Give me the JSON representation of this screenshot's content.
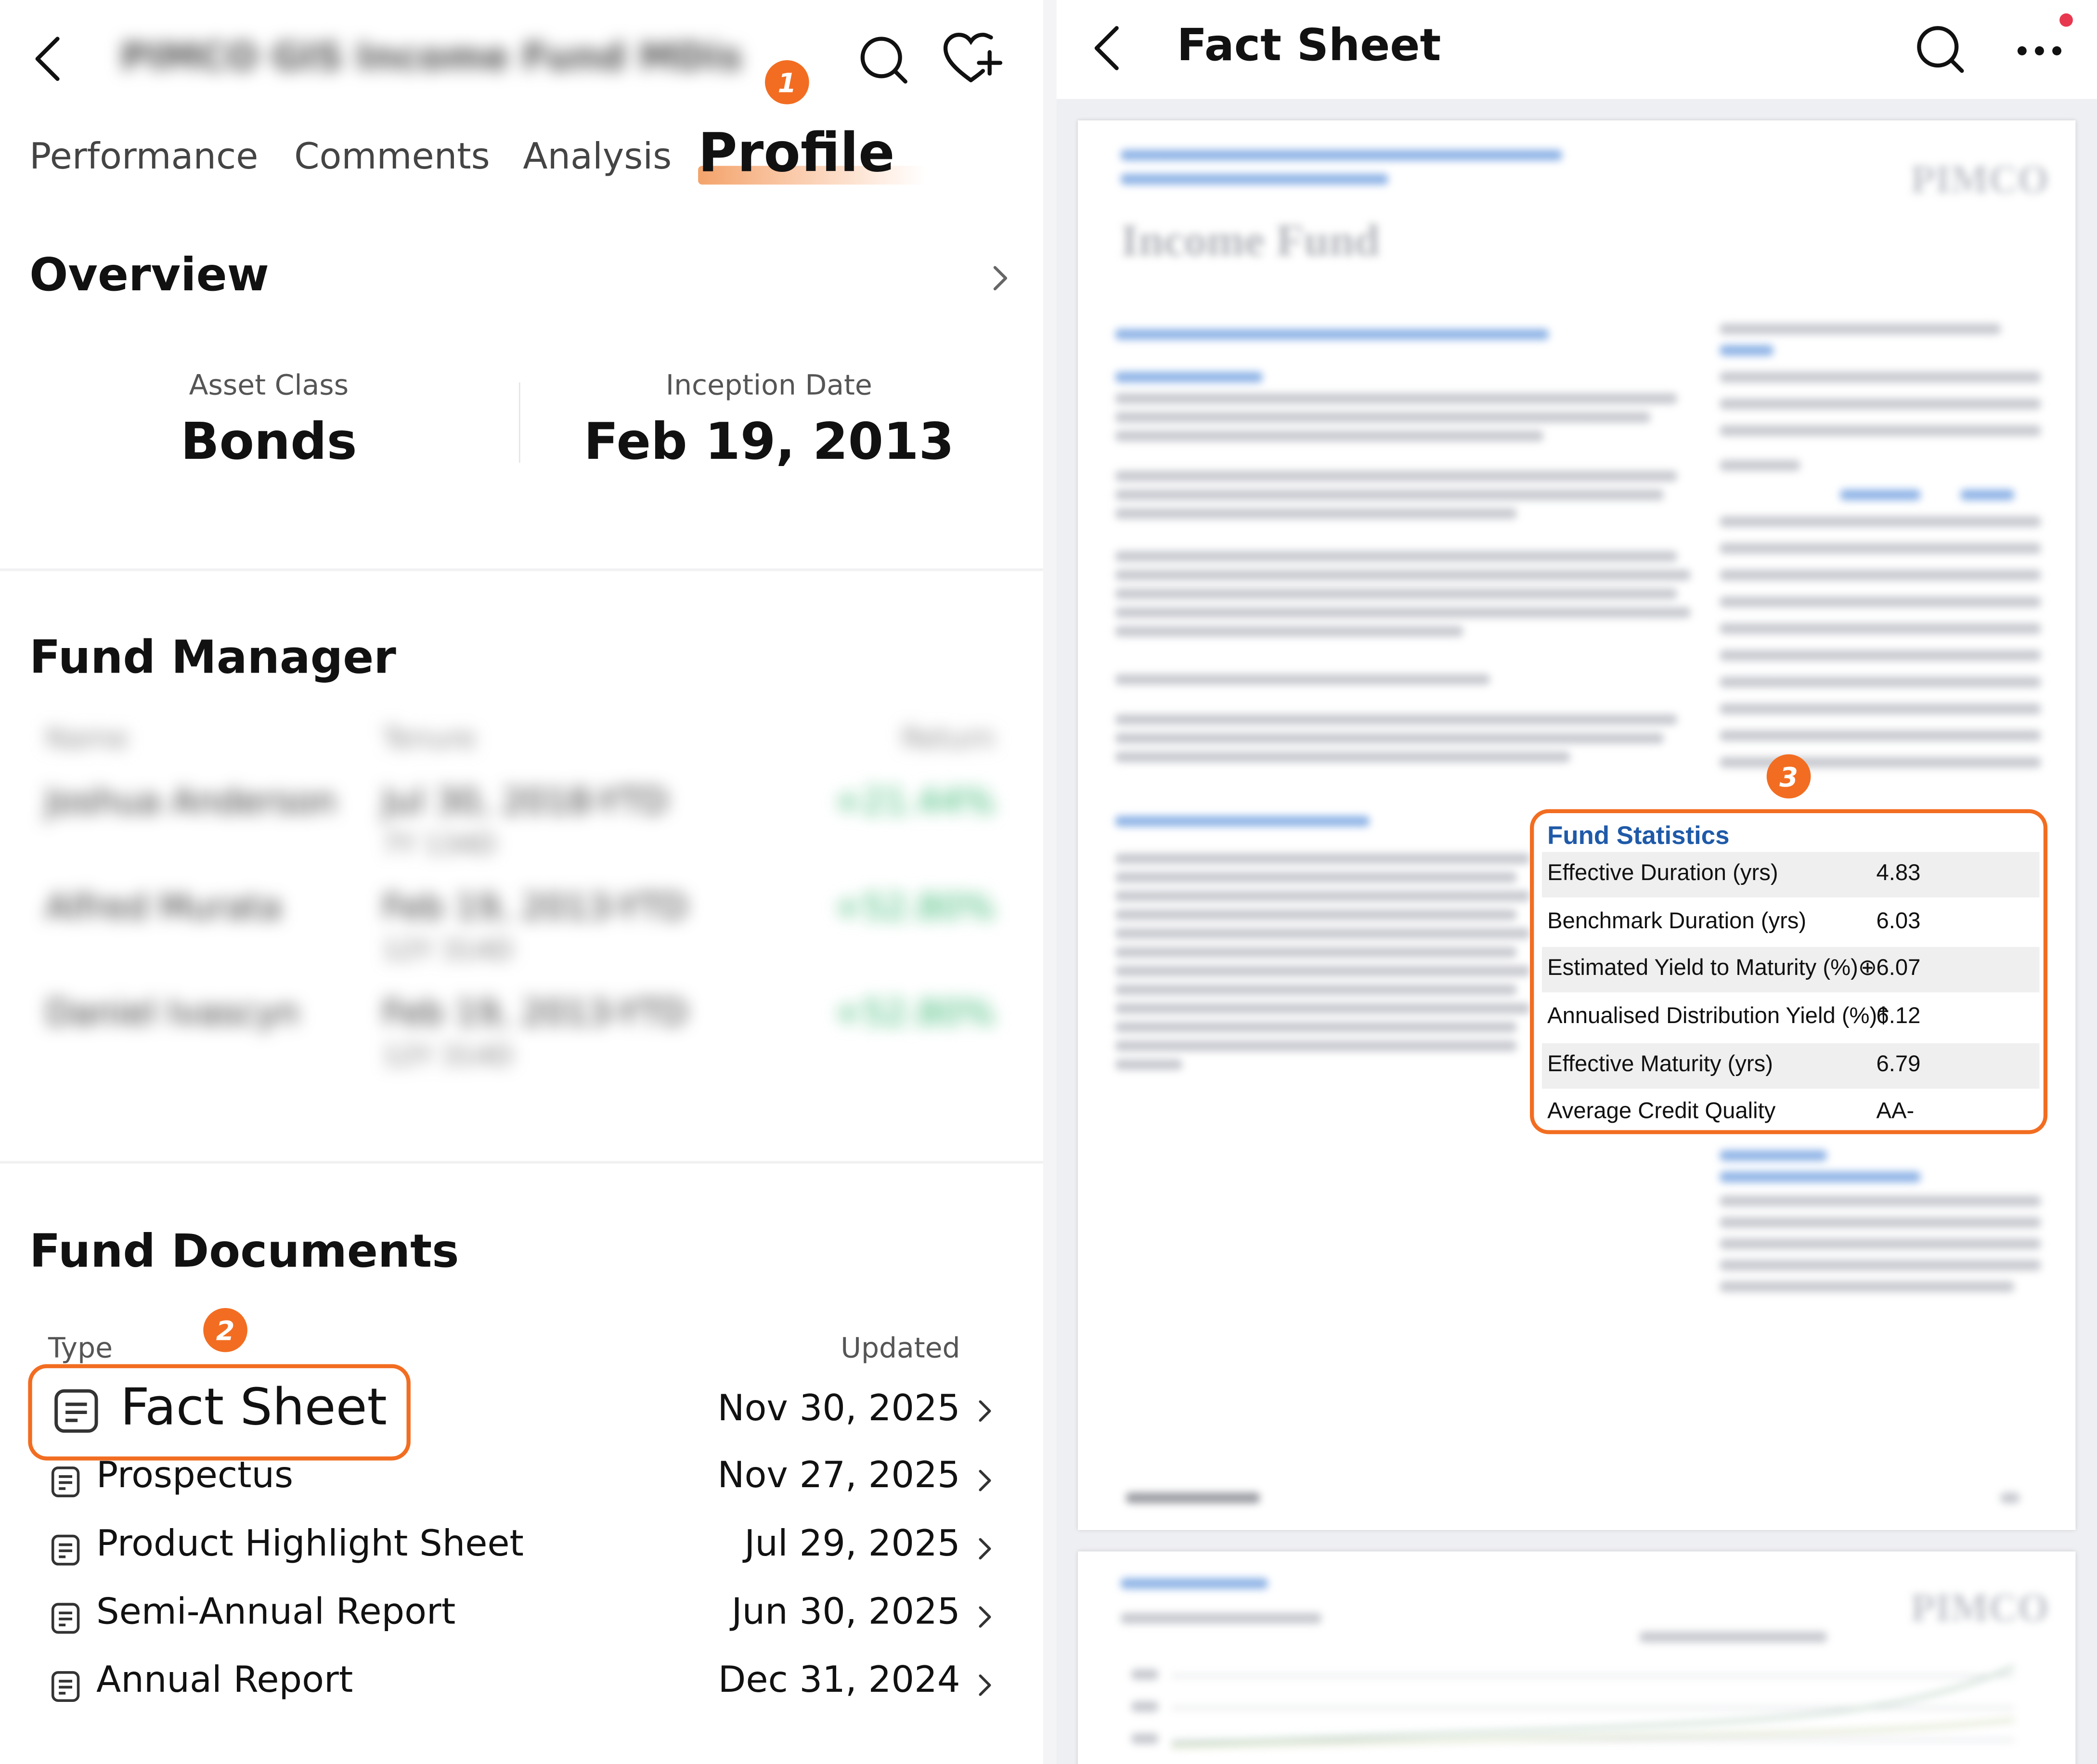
{
  "left": {
    "header": {
      "fund_name": "PIMCO GIS Income Fund MDis"
    },
    "tabs": [
      {
        "label": "Performance",
        "active": false
      },
      {
        "label": "Comments",
        "active": false
      },
      {
        "label": "Analysis",
        "active": false
      },
      {
        "label": "Profile",
        "active": true
      }
    ],
    "overview": {
      "title": "Overview",
      "stats": [
        {
          "label": "Asset Class",
          "value": "Bonds"
        },
        {
          "label": "Inception Date",
          "value": "Feb 19, 2013"
        }
      ]
    },
    "fund_manager": {
      "title": "Fund Manager",
      "columns": [
        "Name",
        "Tenure",
        "Return"
      ],
      "rows": [
        {
          "name": "Joshua Anderson",
          "tenure": "Jul 30, 2018-YTD",
          "tenure_sub": "7Y 134D",
          "return": "+21.44%"
        },
        {
          "name": "Alfred Murata",
          "tenure": "Feb 19, 2013-YTD",
          "tenure_sub": "12Y 314D",
          "return": "+52.80%"
        },
        {
          "name": "Daniel Ivascyn",
          "tenure": "Feb 19, 2013-YTD",
          "tenure_sub": "12Y 314D",
          "return": "+52.80%"
        }
      ]
    },
    "fund_documents": {
      "title": "Fund Documents",
      "col_type": "Type",
      "col_updated": "Updated",
      "rows": [
        {
          "name": "Fact Sheet",
          "date": "Nov 30, 2025"
        },
        {
          "name": "Prospectus",
          "date": "Nov 27, 2025"
        },
        {
          "name": "Product Highlight Sheet",
          "date": "Jul 29, 2025"
        },
        {
          "name": "Semi-Annual Report",
          "date": "Jun 30, 2025"
        },
        {
          "name": "Annual Report",
          "date": "Dec 31, 2024"
        }
      ]
    }
  },
  "badges": [
    "1",
    "2",
    "3"
  ],
  "right": {
    "header": {
      "title": "Fact Sheet"
    },
    "document": {
      "heading": "Income Fund",
      "brand": "PIMCO",
      "fund_statistics": {
        "title": "Fund Statistics",
        "rows": [
          {
            "label": "Effective Duration (yrs)",
            "value": "4.83"
          },
          {
            "label": "Benchmark Duration (yrs)",
            "value": "6.03"
          },
          {
            "label": "Estimated Yield to Maturity (%)⊕",
            "value": "6.07"
          },
          {
            "label": "Annualised Distribution Yield (%)†",
            "value": "6.12"
          },
          {
            "label": "Effective Maturity (yrs)",
            "value": "6.79"
          },
          {
            "label": "Average Credit Quality",
            "value": "AA-"
          }
        ]
      }
    }
  },
  "colors": {
    "accent": "#f26d21",
    "positive": "#2fb36a",
    "link_blue": "#1f5aa8"
  },
  "icons": [
    "back-arrow-icon",
    "search-icon",
    "heart-plus-icon",
    "chevron-right-icon",
    "document-icon",
    "more-icon",
    "notification-dot-icon"
  ]
}
